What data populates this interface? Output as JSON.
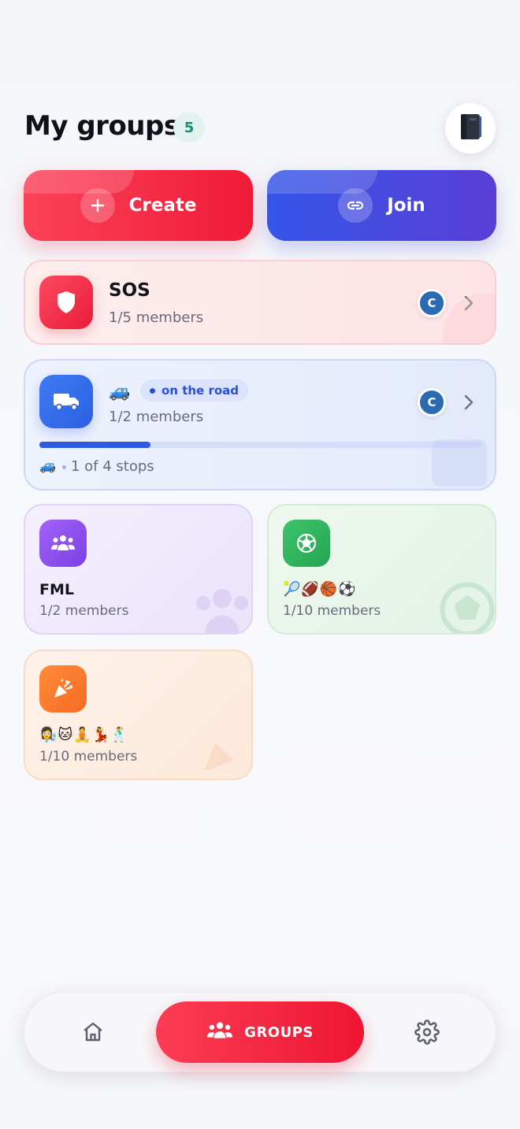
{
  "header": {
    "title": "My groups",
    "group_count": "5"
  },
  "actions": {
    "create_label": "Create",
    "join_label": "Join"
  },
  "groups": [
    {
      "name": "SOS",
      "members": "1/5 members",
      "avatar": "C",
      "icon": "shield-icon",
      "color": "#f0233f"
    },
    {
      "name_emoji": "🚙",
      "status": "on the road",
      "members": "1/2 members",
      "avatar": "C",
      "icon": "truck-icon",
      "color": "#2f63e6",
      "trip": {
        "vehicle_emoji": "🚙",
        "stops_text": "1 of 4 stops",
        "progress": 0.25
      }
    },
    {
      "name": "FML",
      "members": "1/2 members",
      "icon": "people-icon",
      "color": "#8b4cee"
    },
    {
      "name": "🎾🏈🏀⚽",
      "members": "1/10 members",
      "icon": "soccer-ball-icon",
      "color": "#2db35c"
    },
    {
      "name": "👩‍🔬🐱🧘💃🕺",
      "members": "1/10 members",
      "icon": "party-popper-icon",
      "color": "#f5782a"
    }
  ],
  "nav": {
    "home_icon": "home-icon",
    "active_label": "GROUPS",
    "settings_icon": "gear-icon"
  }
}
